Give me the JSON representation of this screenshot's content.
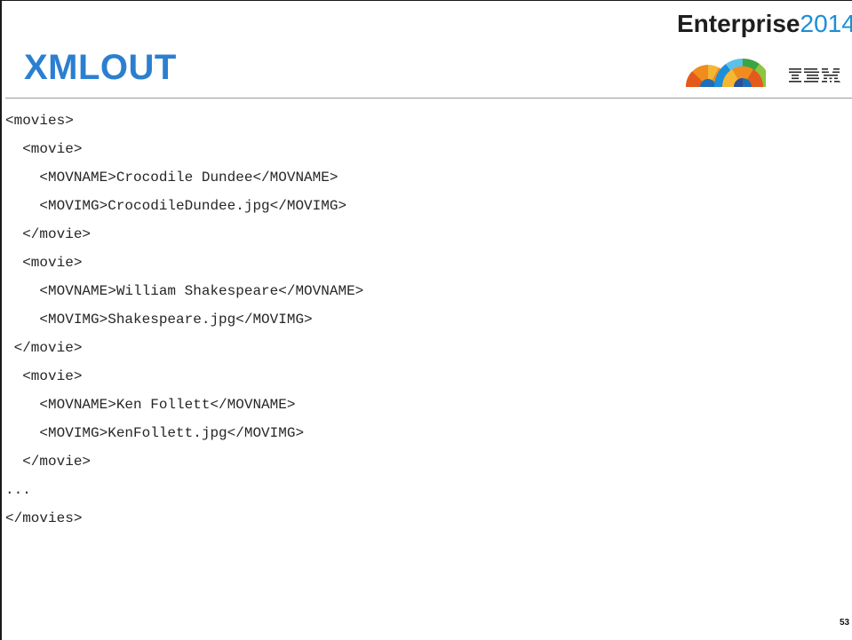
{
  "header": {
    "title": "XMLOUT",
    "brand": {
      "name": "Enterprise",
      "year": "2014",
      "name_color": "#1e1e1e",
      "year_color": "#1a8fd8"
    },
    "logo_icon": "ibm-logo-icon",
    "art_icon": "enterprise-arcs-icon",
    "title_color": "#2b7fd0"
  },
  "code": {
    "lines": [
      "<movies>",
      "  <movie>",
      "    <MOVNAME>Crocodile Dundee</MOVNAME>",
      "    <MOVIMG>CrocodileDundee.jpg</MOVIMG>",
      "  </movie>",
      "  <movie>",
      "    <MOVNAME>William Shakespeare</MOVNAME>",
      "    <MOVIMG>Shakespeare.jpg</MOVIMG>",
      " </movie>",
      "  <movie>",
      "    <MOVNAME>Ken Follett</MOVNAME>",
      "    <MOVIMG>KenFollett.jpg</MOVIMG>",
      "  </movie>",
      "...",
      "</movies>"
    ]
  },
  "footer": {
    "page_number": "53"
  }
}
